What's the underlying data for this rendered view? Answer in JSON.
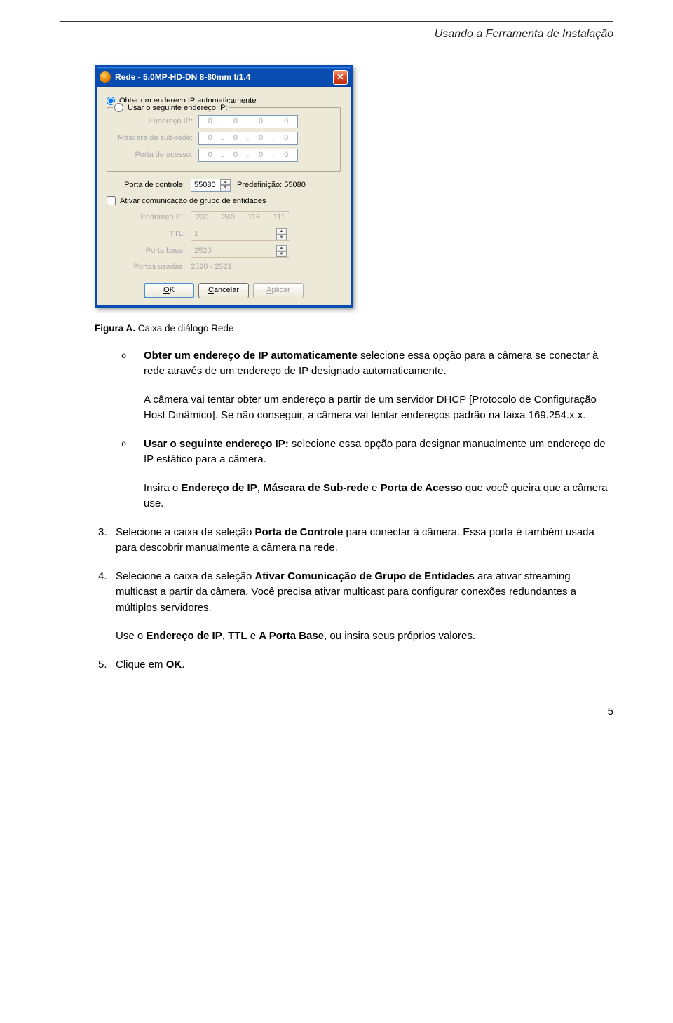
{
  "header": {
    "title": "Usando a Ferramenta de Instalação"
  },
  "dialog": {
    "title": "Rede - 5.0MP-HD-DN 8-80mm f/1.4",
    "radio_auto": "Obter um endereço IP automaticamente",
    "radio_static": "Usar o seguinte endereço IP:",
    "labels": {
      "ip": "Endereço IP:",
      "mask": "Máscara da sub-rede:",
      "port": "Porta de acesso:",
      "ctrlport": "Porta de controle:",
      "predef": "Predefinição: 55080",
      "multicast_cb": "Ativar comunicação de grupo de entidades",
      "mc_ip": "Endereço IP:",
      "ttl": "TTL:",
      "baseport": "Porta base:",
      "usedports": "Portas usadas:"
    },
    "values": {
      "ip": {
        "a": "0",
        "b": "0",
        "c": "0",
        "d": "0"
      },
      "mask": {
        "a": "0",
        "b": "0",
        "c": "0",
        "d": "0"
      },
      "port": {
        "a": "0",
        "b": "0",
        "c": "0",
        "d": "0"
      },
      "ctrlport": "55080",
      "mc_ip": {
        "a": "239",
        "b": "240",
        "c": "116",
        "d": "111"
      },
      "ttl": "1",
      "baseport": "2520",
      "usedports": "2520 - 2521"
    },
    "buttons": {
      "ok_u": "O",
      "ok_rest": "K",
      "cancel_u": "C",
      "cancel_rest": "ancelar",
      "apply_u": "A",
      "apply_rest": "plicar"
    }
  },
  "caption": "Figura A. ",
  "caption_rest": "Caixa de diálogo Rede",
  "body": {
    "o1_strong": "Obter um endereço de IP automaticamente",
    "o1_rest": " selecione essa opção para a câmera se conectar à rede através de um endereço de IP designado automaticamente.",
    "o1_p2": "A câmera vai tentar obter um endereço a partir de um servidor DHCP [Protocolo de Configuração Host Dinâmico]. Se não conseguir, a câmera vai tentar endereços padrão na faixa 169.254.x.x.",
    "o2_strong": "Usar o seguinte endereço IP:",
    "o2_rest": " selecione essa opção para designar manualmente um endereço de IP estático para a câmera.",
    "o2_p2a": "Insira o ",
    "o2_p2b": "Endereço de IP",
    "o2_p2c": ", ",
    "o2_p2d": "Máscara de Sub-rede",
    "o2_p2e": " e ",
    "o2_p2f": "Porta de Acesso",
    "o2_p2g": " que você queira que a câmera use.",
    "n3a": "Selecione a caixa de seleção ",
    "n3b": "Porta de Controle",
    "n3c": " para conectar à câmera. Essa porta é também usada para descobrir manualmente a câmera na rede.",
    "n4a": "Selecione a caixa de seleção ",
    "n4b": "Ativar Comunicação de Grupo de Entidades",
    "n4c": " ara ativar streaming multicast a partir da câmera. Você precisa ativar multicast para configurar conexões redundantes a múltiplos servidores.",
    "n4_p2a": "Use o ",
    "n4_p2b": "Endereço de IP",
    "n4_p2c": ", ",
    "n4_p2d": "TTL",
    "n4_p2e": " e ",
    "n4_p2f": "A Porta Base",
    "n4_p2g": ", ou insira seus próprios valores.",
    "n5a": "Clique em ",
    "n5b": "OK",
    "n5c": "."
  },
  "footer": {
    "page": "5"
  }
}
